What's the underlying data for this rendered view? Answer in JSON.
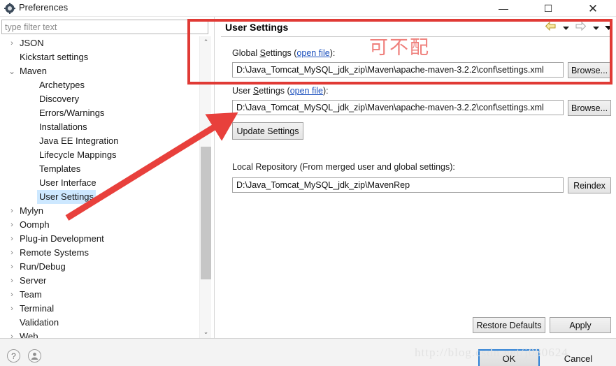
{
  "window": {
    "title": "Preferences",
    "icon": "preferences-icon",
    "minimize_label": "—",
    "maximize_label": "☐",
    "close_label": "✕"
  },
  "filter": {
    "placeholder": "type filter text",
    "value": ""
  },
  "tree": {
    "items": [
      {
        "label": "JSON",
        "indent": 0,
        "twisty": "collapsed",
        "selected": false
      },
      {
        "label": "Kickstart settings",
        "indent": 0,
        "twisty": "none",
        "selected": false
      },
      {
        "label": "Maven",
        "indent": 0,
        "twisty": "expanded",
        "selected": false
      },
      {
        "label": "Archetypes",
        "indent": 1,
        "twisty": "none",
        "selected": false
      },
      {
        "label": "Discovery",
        "indent": 1,
        "twisty": "none",
        "selected": false
      },
      {
        "label": "Errors/Warnings",
        "indent": 1,
        "twisty": "none",
        "selected": false
      },
      {
        "label": "Installations",
        "indent": 1,
        "twisty": "none",
        "selected": false
      },
      {
        "label": "Java EE Integration",
        "indent": 1,
        "twisty": "none",
        "selected": false
      },
      {
        "label": "Lifecycle Mappings",
        "indent": 1,
        "twisty": "none",
        "selected": false
      },
      {
        "label": "Templates",
        "indent": 1,
        "twisty": "none",
        "selected": false
      },
      {
        "label": "User Interface",
        "indent": 1,
        "twisty": "none",
        "selected": false
      },
      {
        "label": "User Settings",
        "indent": 1,
        "twisty": "none",
        "selected": true
      },
      {
        "label": "Mylyn",
        "indent": 0,
        "twisty": "collapsed",
        "selected": false
      },
      {
        "label": "Oomph",
        "indent": 0,
        "twisty": "collapsed",
        "selected": false
      },
      {
        "label": "Plug-in Development",
        "indent": 0,
        "twisty": "collapsed",
        "selected": false
      },
      {
        "label": "Remote Systems",
        "indent": 0,
        "twisty": "collapsed",
        "selected": false
      },
      {
        "label": "Run/Debug",
        "indent": 0,
        "twisty": "collapsed",
        "selected": false
      },
      {
        "label": "Server",
        "indent": 0,
        "twisty": "collapsed",
        "selected": false
      },
      {
        "label": "Team",
        "indent": 0,
        "twisty": "collapsed",
        "selected": false
      },
      {
        "label": "Terminal",
        "indent": 0,
        "twisty": "collapsed",
        "selected": false
      },
      {
        "label": "Validation",
        "indent": 0,
        "twisty": "none",
        "selected": false
      },
      {
        "label": "Web",
        "indent": 0,
        "twisty": "collapsed",
        "selected": false
      }
    ],
    "scrollbar": {
      "up_arrow": "⌃",
      "down_arrow": "⌄"
    }
  },
  "page": {
    "title": "User Settings",
    "nav": {
      "back_icon": "back-arrow-icon",
      "back_menu_icon": "chevron-down-icon",
      "forward_icon": "forward-arrow-icon",
      "forward_menu_icon": "chevron-down-icon",
      "view_menu_icon": "chevron-down-icon"
    },
    "global_settings": {
      "label_before": "Global ",
      "label_underlined": "S",
      "label_after": "ettings (",
      "link": "open file",
      "label_end": "):",
      "value": "D:\\Java_Tomcat_MySQL_jdk_zip\\Maven\\apache-maven-3.2.2\\conf\\settings.xml",
      "browse_label": "Browse..."
    },
    "user_settings": {
      "label_before": "User ",
      "label_underlined": "S",
      "label_after": "ettings (",
      "link": "open file",
      "label_end": "):",
      "value": "D:\\Java_Tomcat_MySQL_jdk_zip\\Maven\\apache-maven-3.2.2\\conf\\settings.xml",
      "browse_label": "Browse...",
      "update_label": "Update Settings"
    },
    "local_repository": {
      "label": "Local Repository (From merged user and global settings):",
      "value": "D:\\Java_Tomcat_MySQL_jdk_zip\\MavenRep",
      "reindex_label": "Reindex"
    },
    "restore_defaults_label": "Restore Defaults",
    "apply_label": "Apply"
  },
  "dialog": {
    "ok_label": "OK",
    "cancel_label": "Cancel",
    "help_icon": "?",
    "account_icon": "●"
  },
  "annotations": {
    "chinese_note": "可不配",
    "red_box_color": "#e03a35",
    "arrow_color": "#e8403c",
    "watermark": "http://blog.csdn.net/j080624"
  }
}
